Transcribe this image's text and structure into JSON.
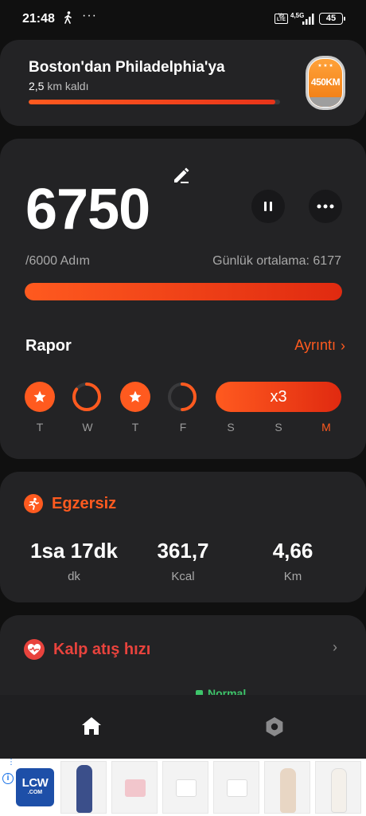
{
  "status_bar": {
    "time": "21:48",
    "network": "4,5G",
    "volte": "Vo LTE",
    "battery": "45"
  },
  "route": {
    "title": "Boston'dan Philadelphia'ya",
    "remaining_value": "2,5",
    "remaining_unit": " km kaldı",
    "progress_fraction": 0.98,
    "badge_label": "450KM",
    "badge_stars": "★ ★ ★"
  },
  "steps": {
    "count": "6750",
    "goal_text": "/6000 Adım",
    "daily_average_text": "Günlük ortalama: 6177",
    "progress_fraction": 1.0,
    "report_label": "Rapor",
    "detail_label": "Ayrıntı",
    "streak_label": "x3",
    "days": [
      {
        "label": "T",
        "state": "done"
      },
      {
        "label": "W",
        "state": "partial",
        "fraction": 0.85
      },
      {
        "label": "T",
        "state": "done"
      },
      {
        "label": "F",
        "state": "partial",
        "fraction": 0.5
      },
      {
        "label": "S",
        "state": "streak"
      },
      {
        "label": "S",
        "state": "streak"
      },
      {
        "label": "M",
        "state": "streak-today"
      }
    ]
  },
  "exercise": {
    "title": "Egzersiz",
    "stats": [
      {
        "value": "1sa 17dk",
        "unit": "dk"
      },
      {
        "value": "361,7",
        "unit": "Kcal"
      },
      {
        "value": "4,66",
        "unit": "Km"
      }
    ]
  },
  "heart": {
    "title": "Kalp atış hızı",
    "status": "Normal"
  },
  "ad": {
    "logo_text": "LCW",
    "logo_sub": ".COM"
  },
  "colors": {
    "accent": "#ff5a1f",
    "heart": "#e8433d",
    "normal": "#3ec56b",
    "card": "#232325",
    "background": "#101010"
  },
  "icons": [
    "walking-icon",
    "more-dots-icon",
    "edit-pencil-icon",
    "pause-icon",
    "more-horizontal-icon",
    "star-icon",
    "running-icon",
    "heart-pulse-icon",
    "chevron-right-icon",
    "home-icon",
    "settings-hex-icon",
    "ad-info-icon"
  ]
}
